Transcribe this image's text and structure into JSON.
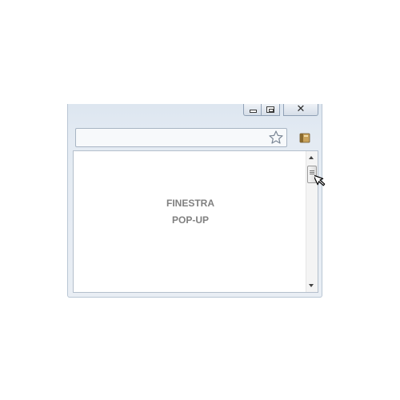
{
  "popup": {
    "content_lines": [
      "FINESTRA",
      "POP-UP"
    ]
  },
  "icons": {
    "minimize": "minimize-icon",
    "maximize": "maximize-icon",
    "close": "close-icon",
    "bookmark": "star-icon",
    "extension": "extension-icon",
    "scroll_up": "scroll-up-arrow-icon",
    "scroll_down": "scroll-down-arrow-icon",
    "cursor": "mouse-pointer-icon"
  },
  "close_glyph": "✕",
  "colors": {
    "frame": "#e4ebf3",
    "content_text": "#808080"
  }
}
